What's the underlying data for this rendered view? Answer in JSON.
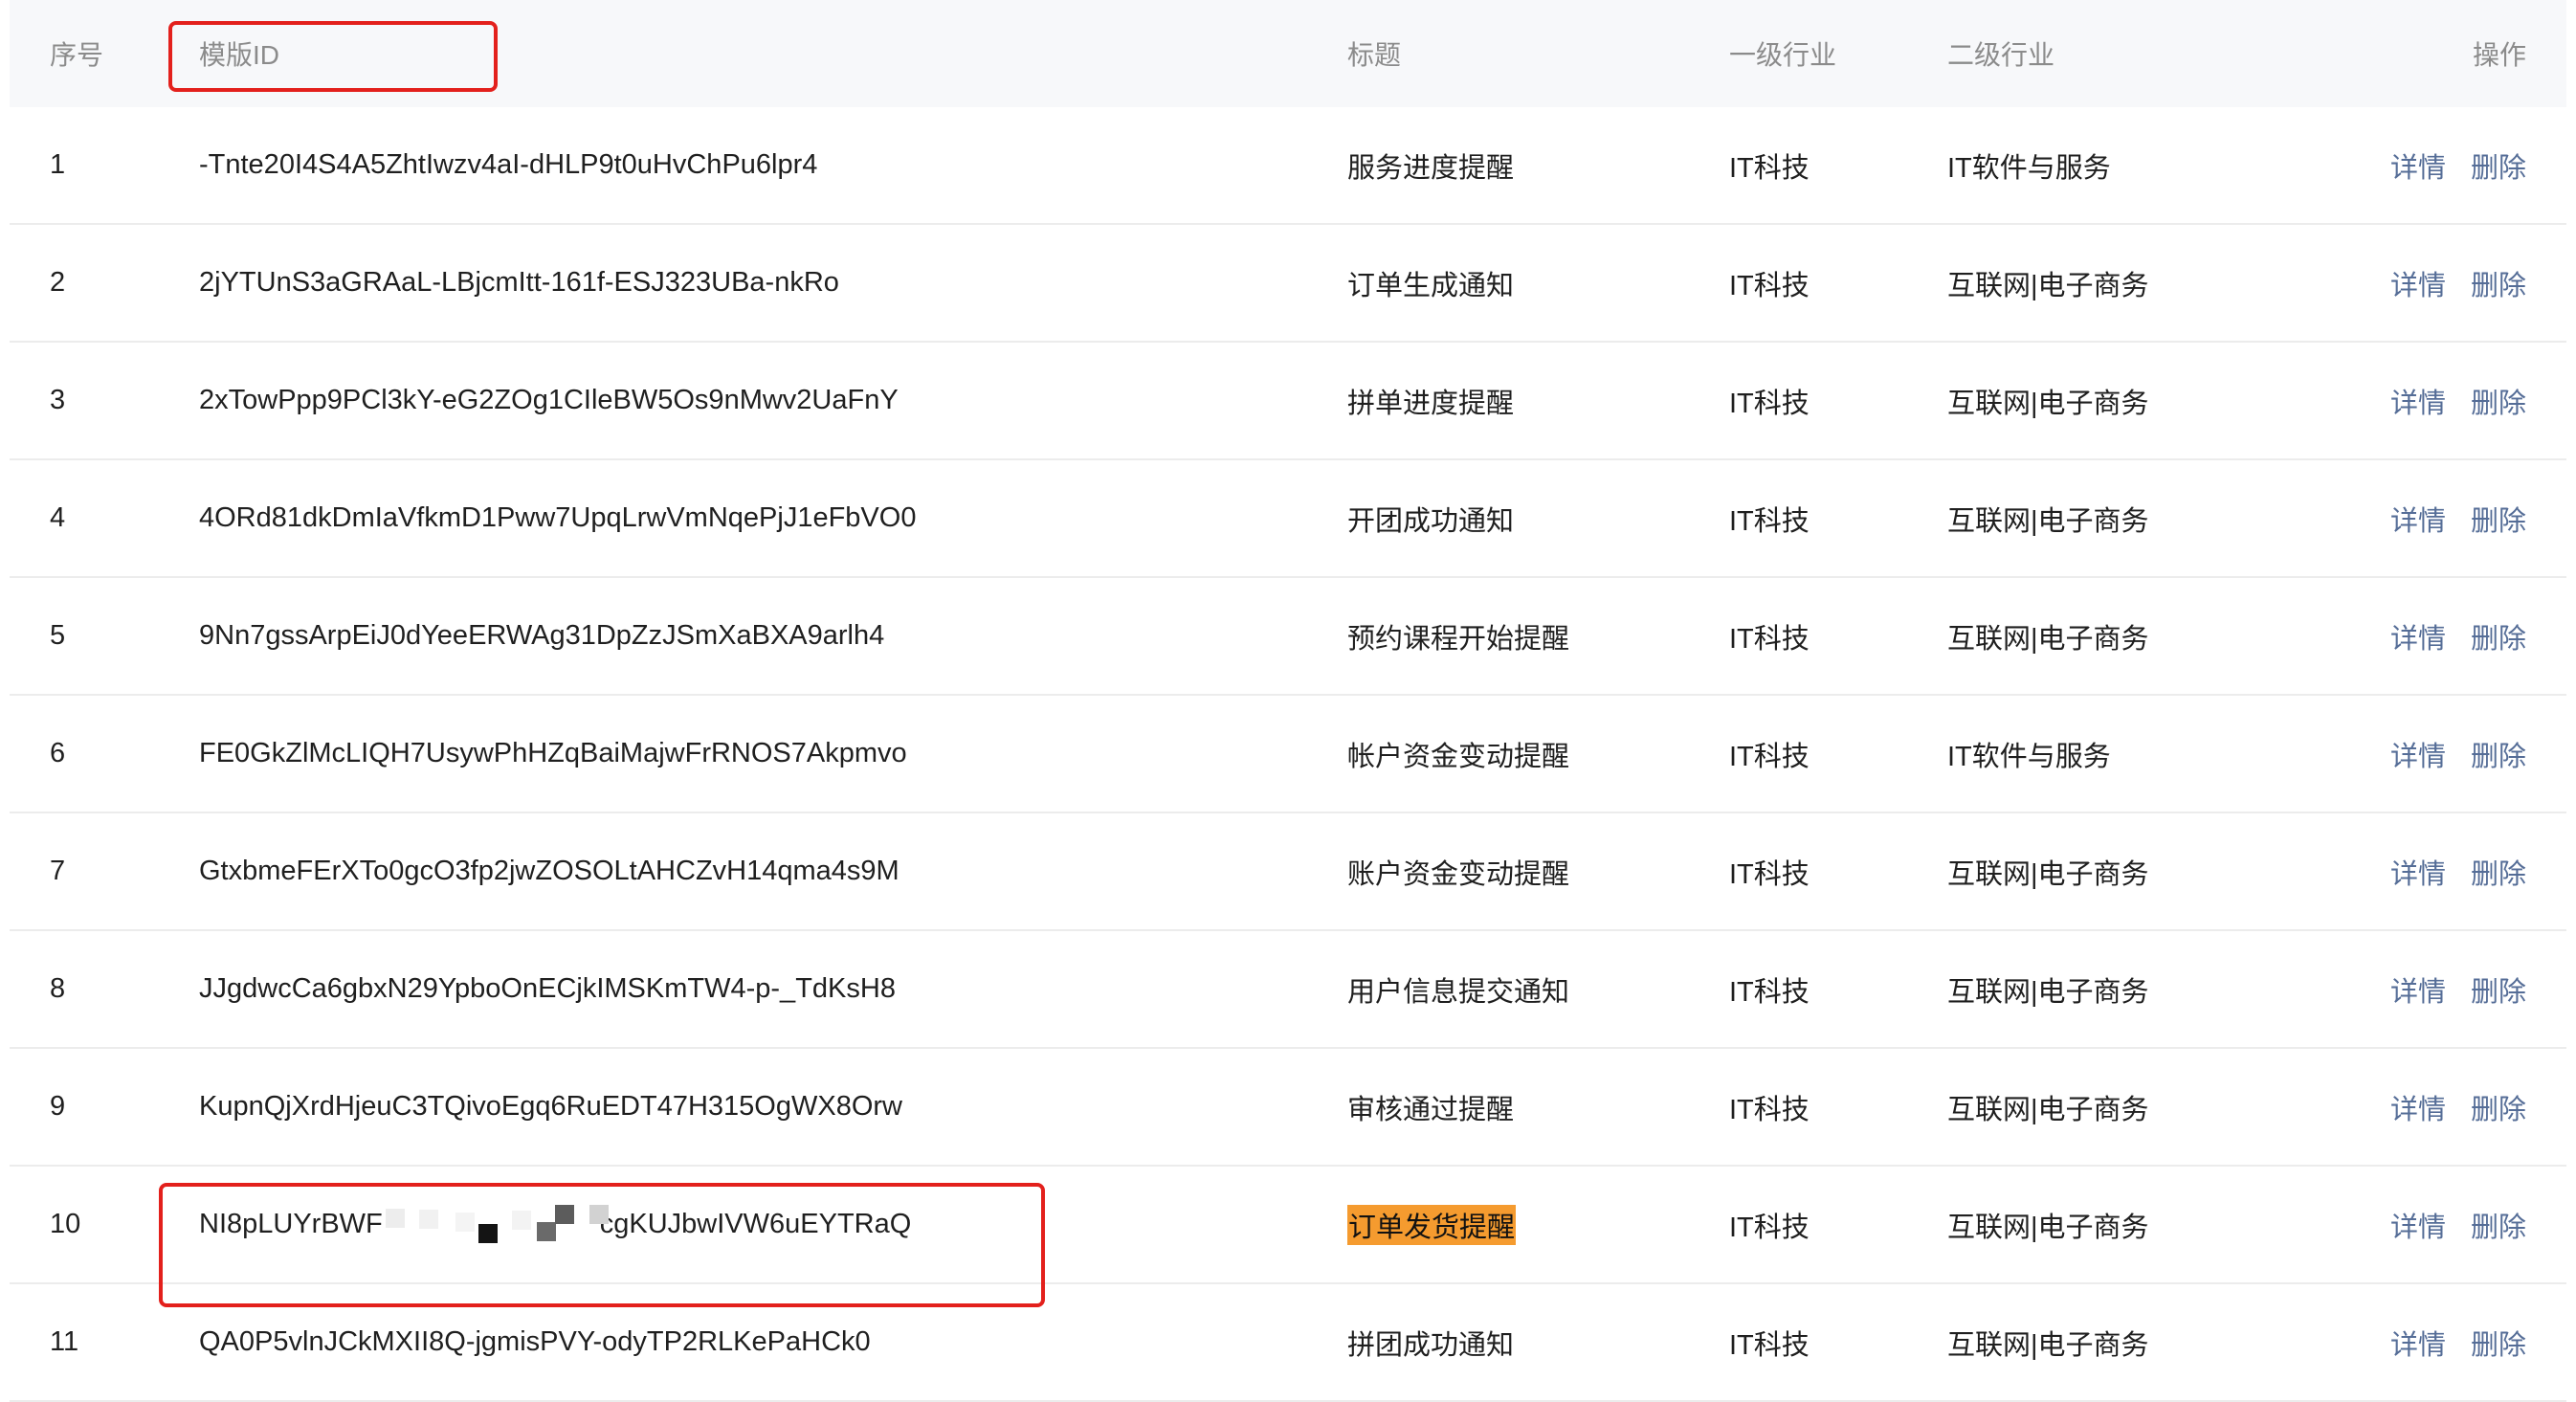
{
  "header": {
    "no": "序号",
    "template_id": "模版ID",
    "title": "标题",
    "industry_primary": "一级行业",
    "industry_secondary": "二级行业",
    "operations": "操作"
  },
  "actions": {
    "detail": "详情",
    "delete": "删除"
  },
  "rows": [
    {
      "no": "1",
      "template_id": "-Tnte20I4S4A5ZhtIwzv4aI-dHLP9t0uHvChPu6lpr4",
      "title": "服务进度提醒",
      "industry_primary": "IT科技",
      "industry_secondary": "IT软件与服务"
    },
    {
      "no": "2",
      "template_id": "2jYTUnS3aGRAaL-LBjcmItt-161f-ESJ323UBa-nkRo",
      "title": "订单生成通知",
      "industry_primary": "IT科技",
      "industry_secondary": "互联网|电子商务"
    },
    {
      "no": "3",
      "template_id": "2xTowPpp9PCl3kY-eG2ZOg1CIleBW5Os9nMwv2UaFnY",
      "title": "拼单进度提醒",
      "industry_primary": "IT科技",
      "industry_secondary": "互联网|电子商务"
    },
    {
      "no": "4",
      "template_id": "4ORd81dkDmIaVfkmD1Pww7UpqLrwVmNqePjJ1eFbVO0",
      "title": "开团成功通知",
      "industry_primary": "IT科技",
      "industry_secondary": "互联网|电子商务"
    },
    {
      "no": "5",
      "template_id": "9Nn7gssArpEiJ0dYeeERWAg31DpZzJSmXaBXA9arlh4",
      "title": "预约课程开始提醒",
      "industry_primary": "IT科技",
      "industry_secondary": "互联网|电子商务"
    },
    {
      "no": "6",
      "template_id": "FE0GkZlMcLIQH7UsywPhHZqBaiMajwFrRNOS7Akpmvo",
      "title": "帐户资金变动提醒",
      "industry_primary": "IT科技",
      "industry_secondary": "IT软件与服务"
    },
    {
      "no": "7",
      "template_id": "GtxbmeFErXTo0gcO3fp2jwZOSOLtAHCZvH14qma4s9M",
      "title": "账户资金变动提醒",
      "industry_primary": "IT科技",
      "industry_secondary": "互联网|电子商务"
    },
    {
      "no": "8",
      "template_id": "JJgdwcCa6gbxN29YpboOnECjkIMSKmTW4-p-_TdKsH8",
      "title": "用户信息提交通知",
      "industry_primary": "IT科技",
      "industry_secondary": "互联网|电子商务"
    },
    {
      "no": "9",
      "template_id": "KupnQjXrdHjeuC3TQivoEgq6RuEDT47H315OgWX8Orw",
      "title": "审核通过提醒",
      "industry_primary": "IT科技",
      "industry_secondary": "互联网|电子商务"
    },
    {
      "no": "10",
      "template_id_start": "NI8pLUYrBWF",
      "template_id_end": "cgKUJbwIVW6uEYTRaQ",
      "title": "订单发货提醒",
      "industry_primary": "IT科技",
      "industry_secondary": "互联网|电子商务"
    },
    {
      "no": "11",
      "template_id": "QA0P5vlnJCkMXII8Q-jgmisPVY-odyTP2RLKePaHCk0",
      "title": "拼团成功通知",
      "industry_primary": "IT科技",
      "industry_secondary": "互联网|电子商务"
    }
  ],
  "colors": {
    "header_bg": "#f7f8fa",
    "link": "#556d97",
    "highlight": "#f59b2f",
    "annotation_box": "#e3201c"
  }
}
